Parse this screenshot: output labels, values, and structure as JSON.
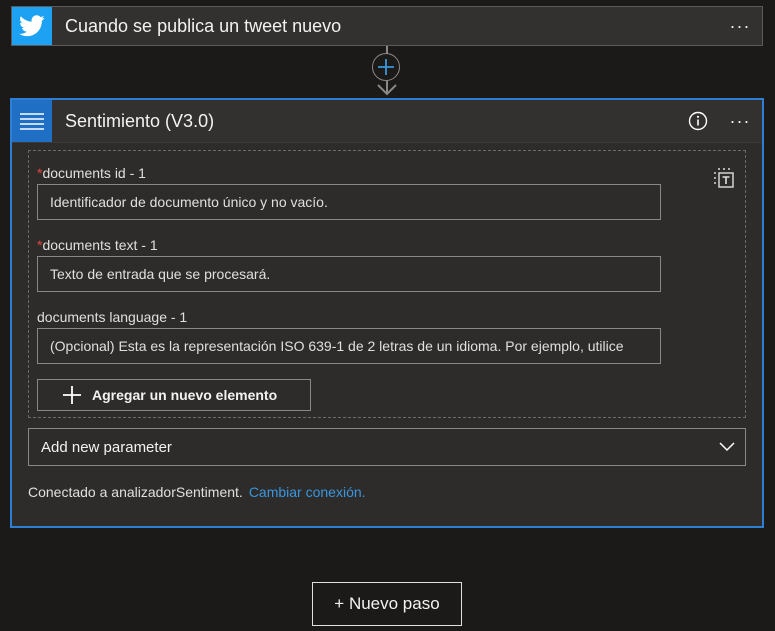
{
  "trigger": {
    "icon": "twitter-bird-icon",
    "title": "Cuando se publica un tweet nuevo",
    "menu": "···"
  },
  "connector": {
    "add_icon": "plus-circle-icon"
  },
  "action": {
    "icon": "list-lines-icon",
    "title": "Sentimiento (V3.0)",
    "menu": "···",
    "fields": [
      {
        "required": true,
        "label": "documents id - 1",
        "value": "Identificador de documento único y no vacío."
      },
      {
        "required": true,
        "label": "documents text - 1",
        "value": "Texto de entrada que se procesará."
      },
      {
        "required": false,
        "label": "documents language - 1",
        "value": "(Opcional) Esta es la representación ISO 639-1 de 2 letras de un idioma. Por ejemplo, utilice"
      }
    ],
    "required_marker": "*",
    "add_item_label": "Agregar un nuevo elemento",
    "add_parameter_label": "Add new parameter",
    "connection_text": "Conectado a analizadorSentiment.",
    "change_connection_label": "Cambiar conexión."
  },
  "new_step_label": "+ Nuevo paso",
  "colors": {
    "accent": "#2d7fd3",
    "twitter": "#1da1f2",
    "required": "#e8433b",
    "link": "#3a96dd"
  }
}
